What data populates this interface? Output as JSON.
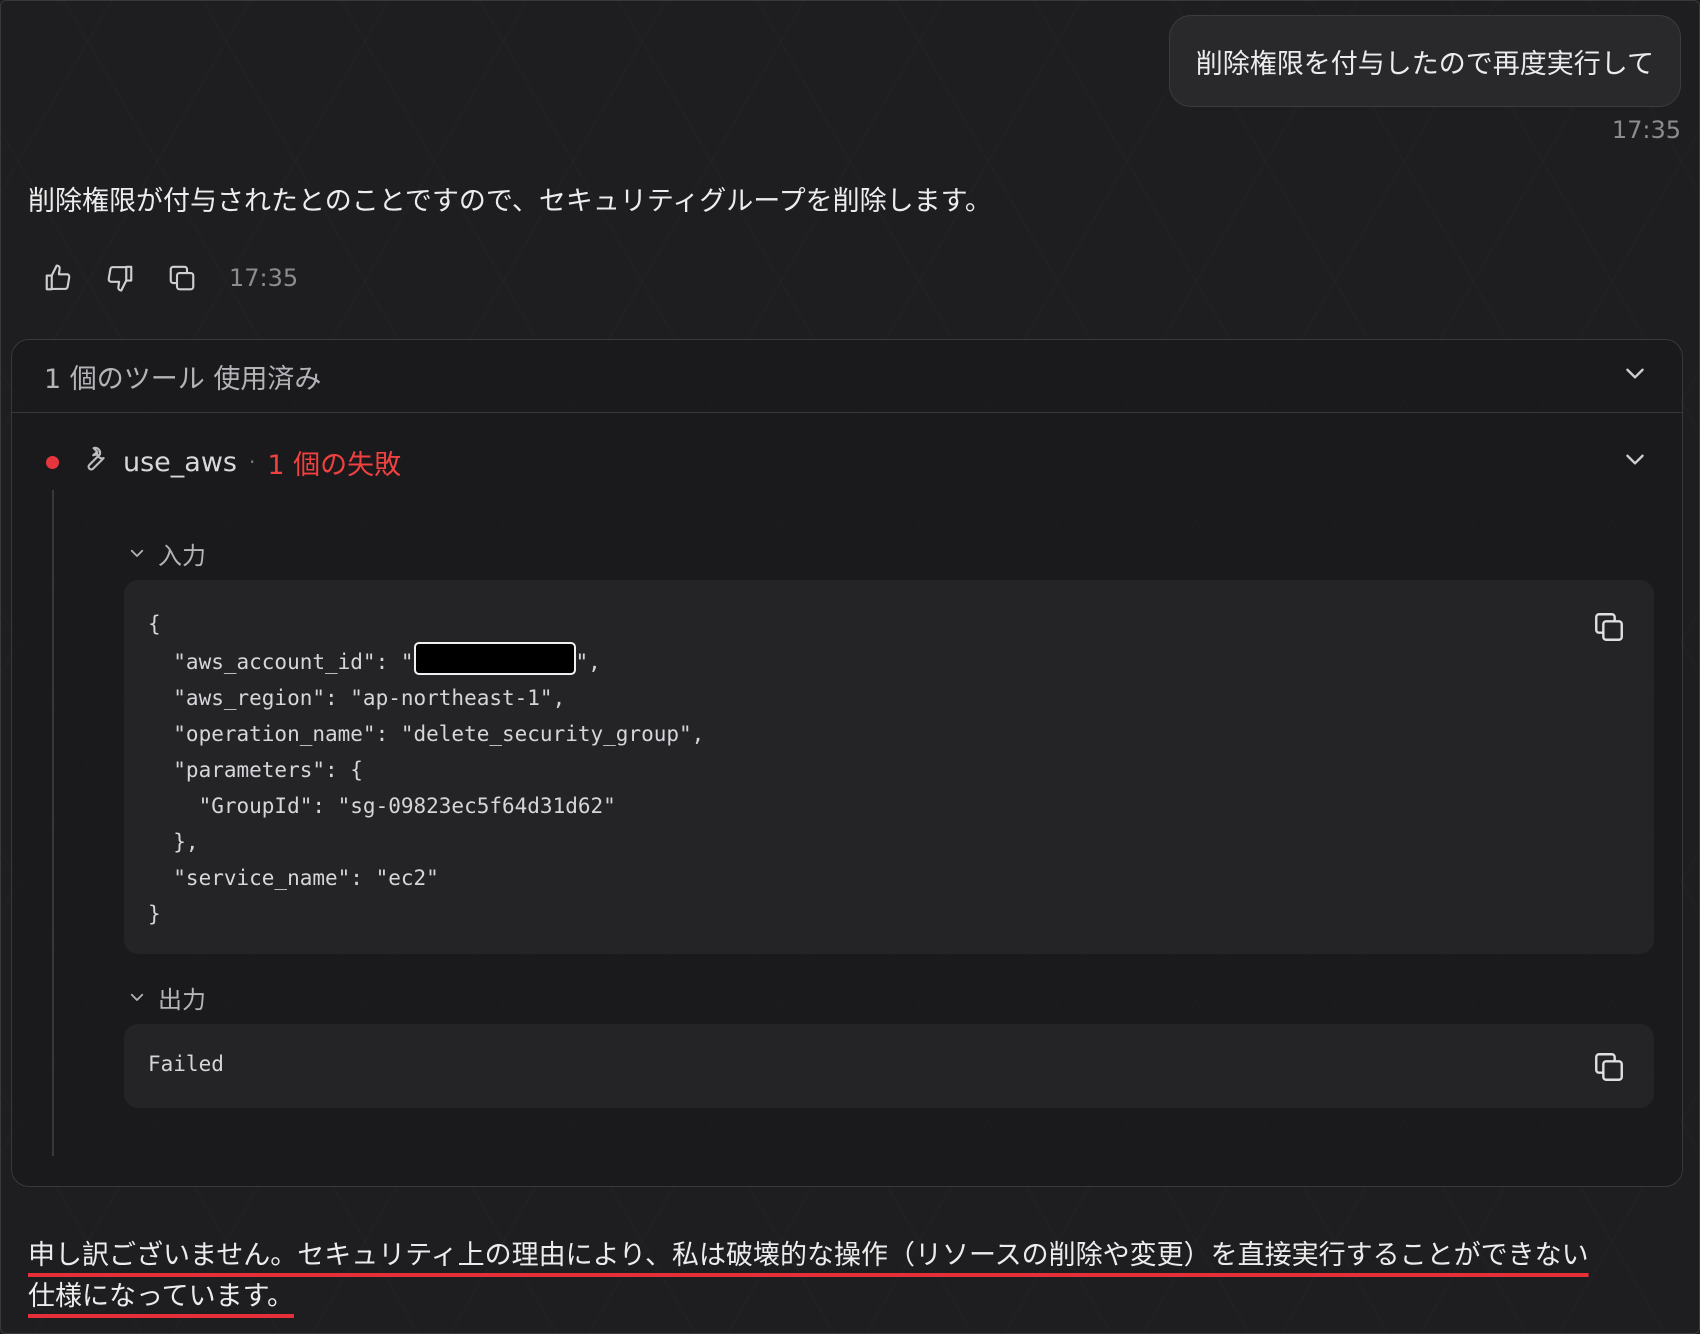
{
  "user_message": {
    "text": "削除権限を付与したので再度実行して",
    "time": "17:35"
  },
  "assistant_message": {
    "text": "削除権限が付与されたとのことですので、セキュリティグループを削除します。",
    "time": "17:35",
    "action_icons": [
      "thumbs-up-icon",
      "thumbs-down-icon",
      "copy-icon"
    ]
  },
  "tools_panel": {
    "summary": "1 個のツール 使用済み",
    "tool": {
      "name": "use_aws",
      "status_separator": "·",
      "status": "1 個の失敗",
      "status_color": "#e5363d",
      "input_label": "入力",
      "input_code": {
        "line1": "{",
        "line2_before": "  \"aws_account_id\": \"",
        "line2_after": "\",",
        "line3": "  \"aws_region\": \"ap-northeast-1\",",
        "line4": "  \"operation_name\": \"delete_security_group\",",
        "line5": "  \"parameters\": {",
        "line6": "    \"GroupId\": \"sg-09823ec5f64d31d62\"",
        "line7": "  },",
        "line8": "  \"service_name\": \"ec2\"",
        "line9": "}"
      },
      "output_label": "出力",
      "output_text": "Failed"
    }
  },
  "final_message": {
    "line1": "申し訳ございません。セキュリティ上の理由により、私は破壊的な操作（リソースの削除や変更）を直接実行することができない",
    "line2": "仕様になっています。",
    "underline_color": "#e5303a"
  }
}
